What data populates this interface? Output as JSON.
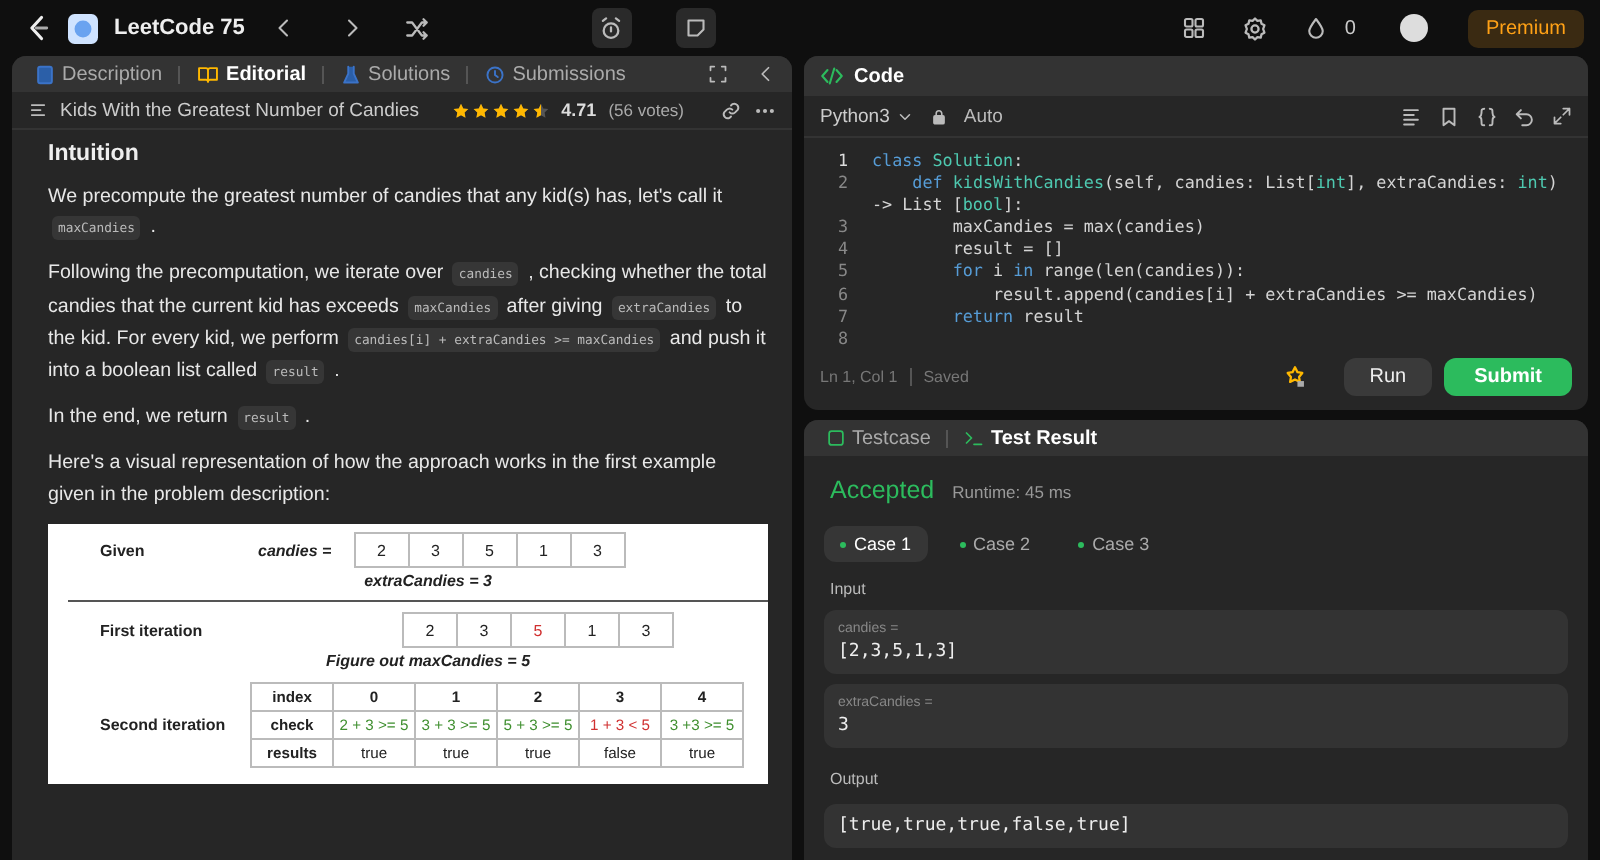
{
  "nav": {
    "list_title": "LeetCode 75",
    "streak": "0",
    "premium": "Premium"
  },
  "left_tabs": [
    {
      "label": "Description",
      "selected": false,
      "kind": "doc"
    },
    {
      "label": "Editorial",
      "selected": true,
      "kind": "book"
    },
    {
      "label": "Solutions",
      "selected": false,
      "kind": "flask"
    },
    {
      "label": "Submissions",
      "selected": false,
      "kind": "clock"
    }
  ],
  "problem": {
    "title": "Kids With the Greatest Number of Candies",
    "stars": 4.5,
    "rating": "4.71",
    "votes": "(56 votes)"
  },
  "editorial": {
    "heading": "Intuition",
    "paragraphs": [
      {
        "segments": [
          {
            "kind": "text",
            "text": "We precompute the greatest number of candies that any kid(s) has, let's call it "
          },
          {
            "kind": "code",
            "text": "maxCandies"
          },
          {
            "kind": "text",
            "text": " ."
          }
        ]
      },
      {
        "segments": [
          {
            "kind": "text",
            "text": "Following the precomputation, we iterate over "
          },
          {
            "kind": "code",
            "text": "candies"
          },
          {
            "kind": "text",
            "text": " , checking whether the total candies that the current kid has exceeds "
          },
          {
            "kind": "code",
            "text": "maxCandies"
          },
          {
            "kind": "text",
            "text": " after giving "
          },
          {
            "kind": "code",
            "text": "extraCandies"
          },
          {
            "kind": "text",
            "text": " to the kid. For every kid, we perform "
          },
          {
            "kind": "code",
            "text": "candies[i] + extraCandies >= maxCandies"
          },
          {
            "kind": "text",
            "text": " and push it into a boolean list called "
          },
          {
            "kind": "code",
            "text": "result"
          },
          {
            "kind": "text",
            "text": " ."
          }
        ]
      },
      {
        "segments": [
          {
            "kind": "text",
            "text": "In the end, we return "
          },
          {
            "kind": "code",
            "text": "result"
          },
          {
            "kind": "text",
            "text": " ."
          }
        ]
      },
      {
        "segments": [
          {
            "kind": "text",
            "text": "Here's a visual representation of how the approach works in the first example given in the problem description:"
          }
        ]
      }
    ]
  },
  "figure": {
    "given_label": "Given",
    "array_label": "candies =",
    "given_cells": [
      "2",
      "3",
      "5",
      "1",
      "3"
    ],
    "extra_note": "extraCandies = 3",
    "first_label": "First iteration",
    "first_cells": [
      {
        "text": "2",
        "highlight": false
      },
      {
        "text": "3",
        "highlight": false
      },
      {
        "text": "5",
        "highlight": true
      },
      {
        "text": "1",
        "highlight": false
      },
      {
        "text": "3",
        "highlight": false
      }
    ],
    "first_note": "Figure out maxCandies = 5",
    "second_label": "Second iteration",
    "table_header": [
      "index",
      "0",
      "1",
      "2",
      "3",
      "4"
    ],
    "check_label": "check",
    "checks": [
      {
        "text": "2 + 3 >= 5",
        "color": "#3f8f2f"
      },
      {
        "text": "3 + 3 >= 5",
        "color": "#3f8f2f"
      },
      {
        "text": "5 + 3 >= 5",
        "color": "#3f8f2f"
      },
      {
        "text": "1 + 3 < 5",
        "color": "#d03030"
      },
      {
        "text": "3 +3 >= 5",
        "color": "#3f8f2f"
      }
    ],
    "results_label": "results",
    "results": [
      "true",
      "true",
      "true",
      "false",
      "true"
    ]
  },
  "code": {
    "title": "Code",
    "language": "Python3",
    "mode": "Auto",
    "lines": [
      {
        "n": "1",
        "tokens": [
          {
            "kind": "kw",
            "text": "class"
          },
          {
            "kind": "cls",
            "text": " Solution"
          },
          {
            "kind": "plain",
            "text": ":"
          }
        ]
      },
      {
        "n": "2",
        "tokens": [
          {
            "kind": "kw",
            "text": "    def"
          },
          {
            "kind": "cls",
            "text": " kidsWithCandies"
          },
          {
            "kind": "plain",
            "text": "(self, candies: List["
          },
          {
            "kind": "cls",
            "text": "int"
          },
          {
            "kind": "plain",
            "text": "], extraCandies: "
          },
          {
            "kind": "cls",
            "text": "int"
          },
          {
            "kind": "plain",
            "text": ") -> List ["
          },
          {
            "kind": "cls",
            "text": "bool"
          },
          {
            "kind": "plain",
            "text": "]:"
          }
        ]
      },
      {
        "n": "3",
        "tokens": [
          {
            "kind": "plain",
            "text": "        maxCandies = max(candies)"
          }
        ]
      },
      {
        "n": "4",
        "tokens": [
          {
            "kind": "plain",
            "text": "        result = []"
          }
        ]
      },
      {
        "n": "5",
        "tokens": [
          {
            "kind": "kw",
            "text": "        for"
          },
          {
            "kind": "plain",
            "text": " i "
          },
          {
            "kind": "kw",
            "text": "in"
          },
          {
            "kind": "plain",
            "text": " range(len(candies)):"
          }
        ]
      },
      {
        "n": "6",
        "tokens": [
          {
            "kind": "plain",
            "text": "            result.append(candies[i] + extraCandies >= maxCandies)"
          }
        ]
      },
      {
        "n": "7",
        "tokens": [
          {
            "kind": "kw",
            "text": "        return"
          },
          {
            "kind": "plain",
            "text": " result"
          }
        ]
      },
      {
        "n": "8"
      }
    ],
    "cursor": "Ln 1, Col 1",
    "save_state": "Saved",
    "run": "Run",
    "submit": "Submit"
  },
  "test_tabs": [
    {
      "label": "Testcase",
      "selected": false
    },
    {
      "label": "Test Result",
      "selected": true
    }
  ],
  "result": {
    "status": "Accepted",
    "runtime": "Runtime: 45 ms",
    "cases": [
      {
        "label": "Case 1",
        "selected": true
      },
      {
        "label": "Case 2",
        "selected": false
      },
      {
        "label": "Case 3",
        "selected": false
      }
    ],
    "input_label": "Input",
    "inputs": [
      {
        "name": "candies =",
        "value": "[2,3,5,1,3]"
      },
      {
        "name": "extraCandies =",
        "value": "3"
      }
    ],
    "output_label": "Output",
    "output": "[true,true,true,false,true]"
  }
}
